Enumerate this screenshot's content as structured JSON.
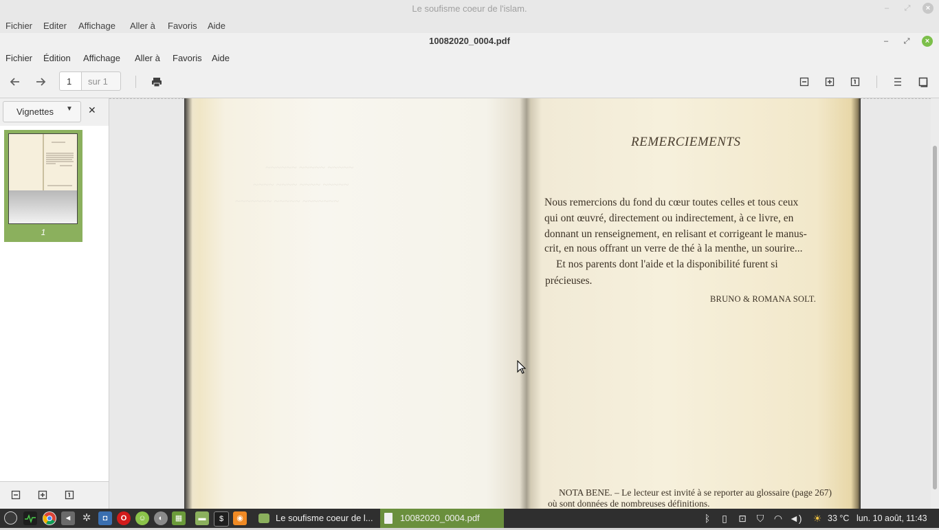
{
  "background_window": {
    "title": "Le soufisme coeur de l'islam.",
    "menu": [
      "Fichier",
      "Editer",
      "Affichage",
      "Aller à",
      "Favoris",
      "Aide"
    ]
  },
  "window": {
    "title": "10082020_0004.pdf",
    "menu": [
      "Fichier",
      "Édition",
      "Affichage",
      "Aller à",
      "Favoris",
      "Aide"
    ]
  },
  "toolbar": {
    "page_value": "1",
    "page_total": "sur 1"
  },
  "sidebar": {
    "selector_label": "Vignettes",
    "thumbnail_label": "1"
  },
  "document": {
    "heading": "REMERCIEMENTS",
    "lines": [
      "Nous remercions du fond du cœur toutes celles et tous ceux",
      "qui ont œuvré, directement ou indirectement, à ce livre, en",
      "donnant un renseignement, en relisant et corrigeant le manus-",
      "crit, en nous offrant un verre de thé à la menthe, un sourire...",
      "Et nos parents dont l'aide et la disponibilité furent si",
      "précieuses."
    ],
    "signature": "BRUNO & ROMANA SOLT.",
    "note_lines": [
      "NOTA BENE. – Le lecteur est invité à se reporter au glossaire (page 267)",
      "où sont données de nombreuses définitions."
    ]
  },
  "taskbar": {
    "tasks": [
      "Le soufisme coeur de l...",
      "10082020_0004.pdf"
    ],
    "temperature": "33 °C",
    "clock": "lun. 10 août, 11:43"
  },
  "colors": {
    "accent_green": "#8bb05d",
    "taskbar_active": "#6a8f3d",
    "close_button": "#7cbf4a"
  }
}
